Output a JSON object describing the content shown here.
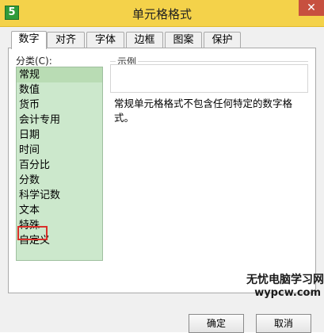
{
  "window": {
    "title": "单元格格式",
    "app_icon_glyph": "5",
    "close_glyph": "✕"
  },
  "tabs": [
    {
      "label": "数字",
      "active": true
    },
    {
      "label": "对齐"
    },
    {
      "label": "字体"
    },
    {
      "label": "边框"
    },
    {
      "label": "图案"
    },
    {
      "label": "保护"
    }
  ],
  "category": {
    "label": "分类(C):",
    "items": [
      "常规",
      "数值",
      "货币",
      "会计专用",
      "日期",
      "时间",
      "百分比",
      "分数",
      "科学记数",
      "文本",
      "特殊",
      "自定义"
    ],
    "selected_index": 0,
    "highlighted_index": 9
  },
  "sample": {
    "label": "示例",
    "value": ""
  },
  "description": "常规单元格格式不包含任何特定的数字格式。",
  "buttons": {
    "ok": "确定",
    "cancel": "取消"
  },
  "watermark": {
    "line1": "无忧电脑学习网",
    "line2": "wypcw.com"
  },
  "colors": {
    "titlebar": "#f4d24a",
    "list_bg": "#cce8cc",
    "highlight": "#d9302a"
  }
}
